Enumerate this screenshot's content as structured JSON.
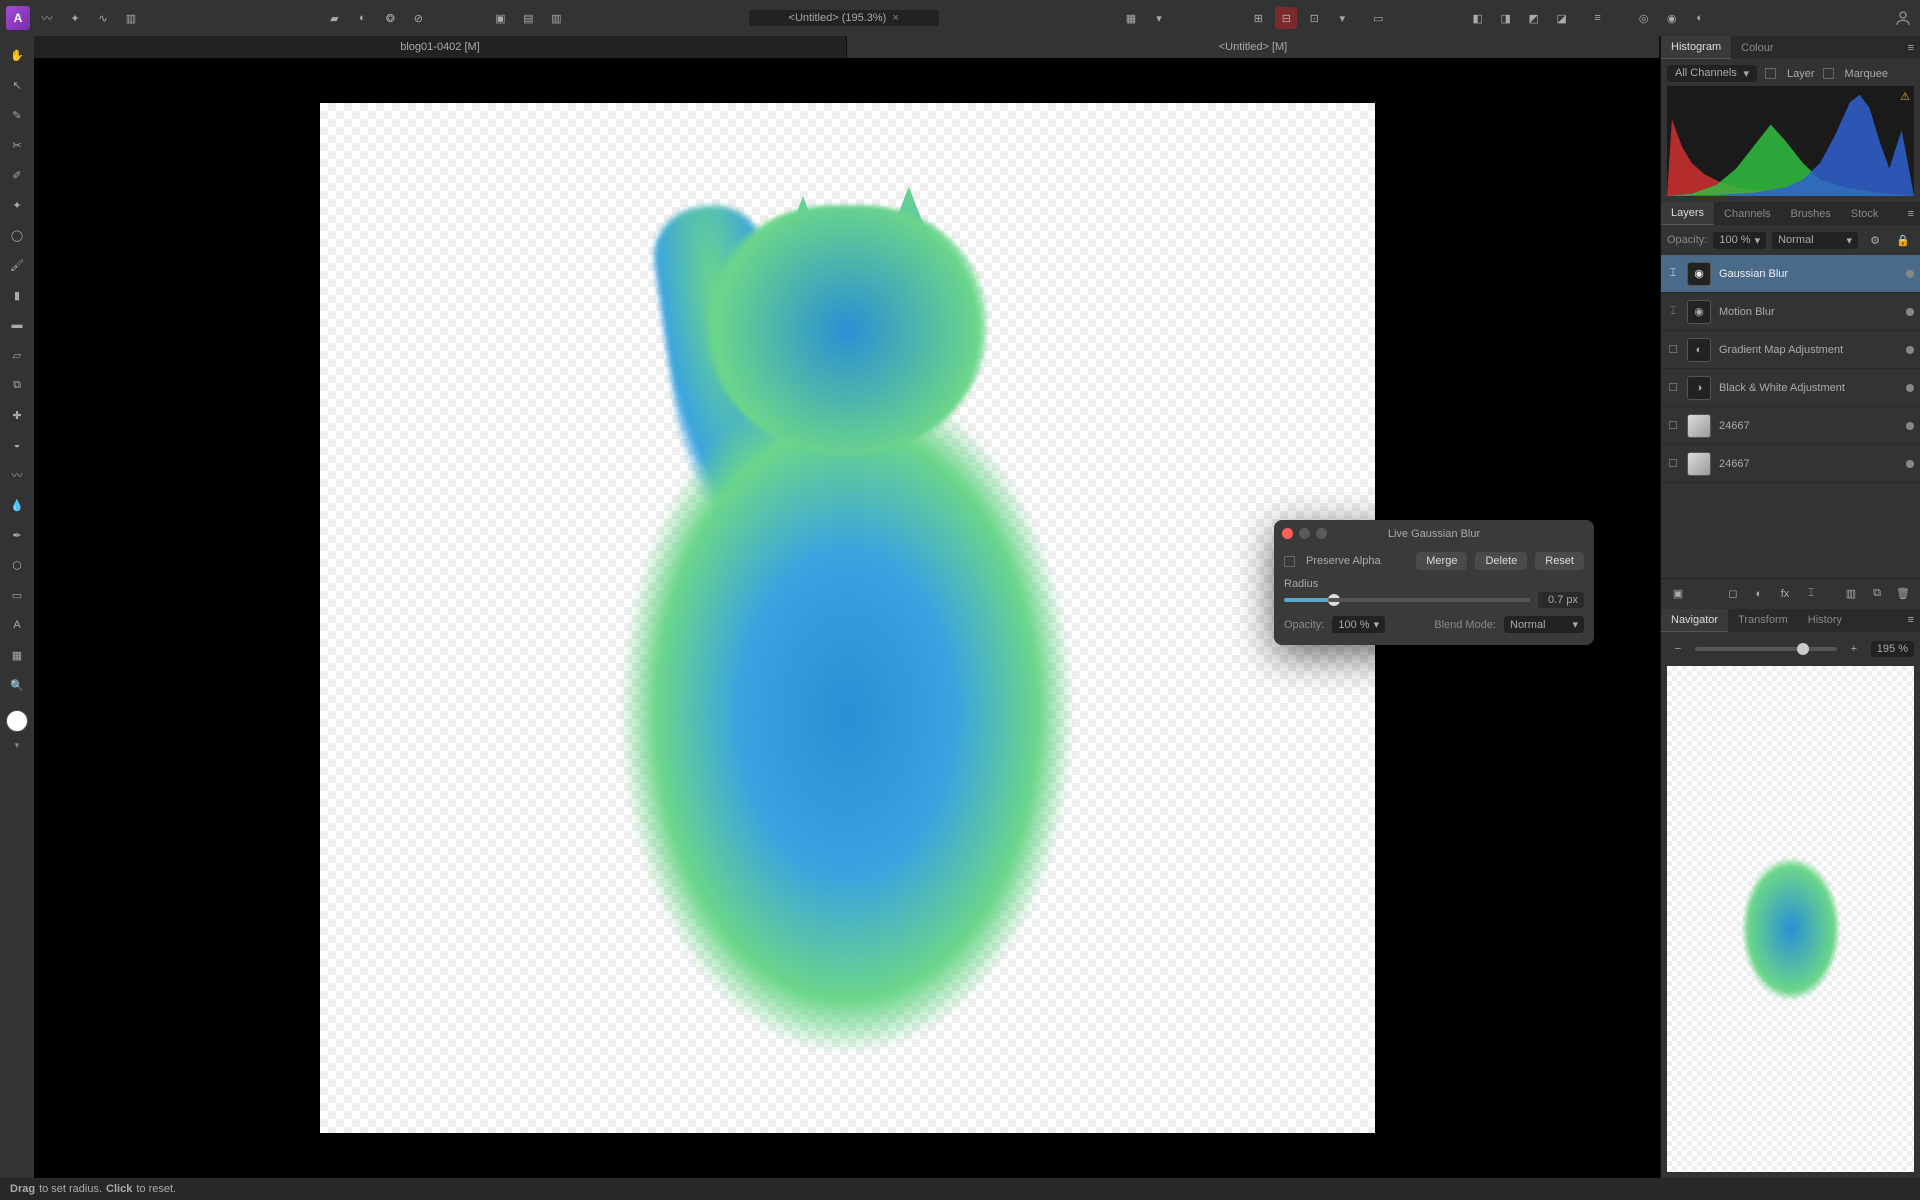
{
  "topbar": {
    "doc_title": "<Untitled> (195.3%)",
    "persona_groups": [
      [
        "app",
        "persona-1",
        "persona-2",
        "persona-3",
        "persona-4"
      ],
      [
        "swatch",
        "circle-half",
        "color-wheel",
        "no-color"
      ],
      [
        "crop-1",
        "crop-2",
        "crop-3"
      ],
      [
        "grid-toggle",
        "chevron"
      ],
      [
        "snap-1",
        "snap-2",
        "snap-3",
        "snap-4"
      ],
      [
        "record"
      ],
      [
        "arrange-1",
        "arrange-2",
        "arrange-3",
        "arrange-4"
      ],
      [
        "align"
      ],
      [
        "group-1",
        "group-2",
        "group-3"
      ],
      [
        "user"
      ]
    ]
  },
  "tools": [
    "hand",
    "move",
    "brush",
    "crop",
    "pen",
    "wand",
    "lasso",
    "clone",
    "heal",
    "dodge",
    "paint",
    "eraser",
    "fill",
    "gradient",
    "smudge",
    "blur",
    "text",
    "shape",
    "mesh",
    "zoom",
    "rect",
    "artistic",
    "perspective",
    "color-picker"
  ],
  "docs": [
    {
      "label": "blog01-0402 [M]",
      "active": false
    },
    {
      "label": "<Untitled> [M]",
      "active": true
    }
  ],
  "status": {
    "pre": "Drag",
    "mid": " to set radius. ",
    "bold2": "Click",
    "post": " to reset."
  },
  "histogram": {
    "tabs": [
      "Histogram",
      "Colour"
    ],
    "channel": "All Channels",
    "layer_label": "Layer",
    "marquee_label": "Marquee"
  },
  "layers_panel": {
    "tabs": [
      "Layers",
      "Channels",
      "Brushes",
      "Stock"
    ],
    "opacity_label": "Opacity:",
    "opacity_value": "100 %",
    "blend_value": "Normal",
    "layers": [
      {
        "name": "Gaussian Blur",
        "thumb": "fx",
        "sel": true,
        "disabled": true
      },
      {
        "name": "Motion Blur",
        "thumb": "fx",
        "sel": false,
        "disabled": true
      },
      {
        "name": "Gradient Map Adjustment",
        "thumb": "adj",
        "sel": false
      },
      {
        "name": "Black & White Adjustment",
        "thumb": "adj",
        "sel": false
      },
      {
        "name": "24667",
        "thumb": "img",
        "sel": false,
        "mask": true
      },
      {
        "name": "24667",
        "thumb": "img",
        "sel": false,
        "mask": true
      }
    ],
    "footer_icons": [
      "fx",
      "mask",
      "adj",
      "live",
      "crop",
      "group",
      "link",
      "delete"
    ]
  },
  "navigator": {
    "tabs": [
      "Navigator",
      "Transform",
      "History"
    ],
    "zoom": "195 %"
  },
  "dialog": {
    "title": "Live Gaussian Blur",
    "preserve_alpha": "Preserve Alpha",
    "merge": "Merge",
    "delete": "Delete",
    "reset": "Reset",
    "radius_label": "Radius",
    "radius_value": "0.7 px",
    "opacity_label": "Opacity:",
    "opacity_value": "100 %",
    "blend_label": "Blend Mode:",
    "blend_value": "Normal"
  }
}
